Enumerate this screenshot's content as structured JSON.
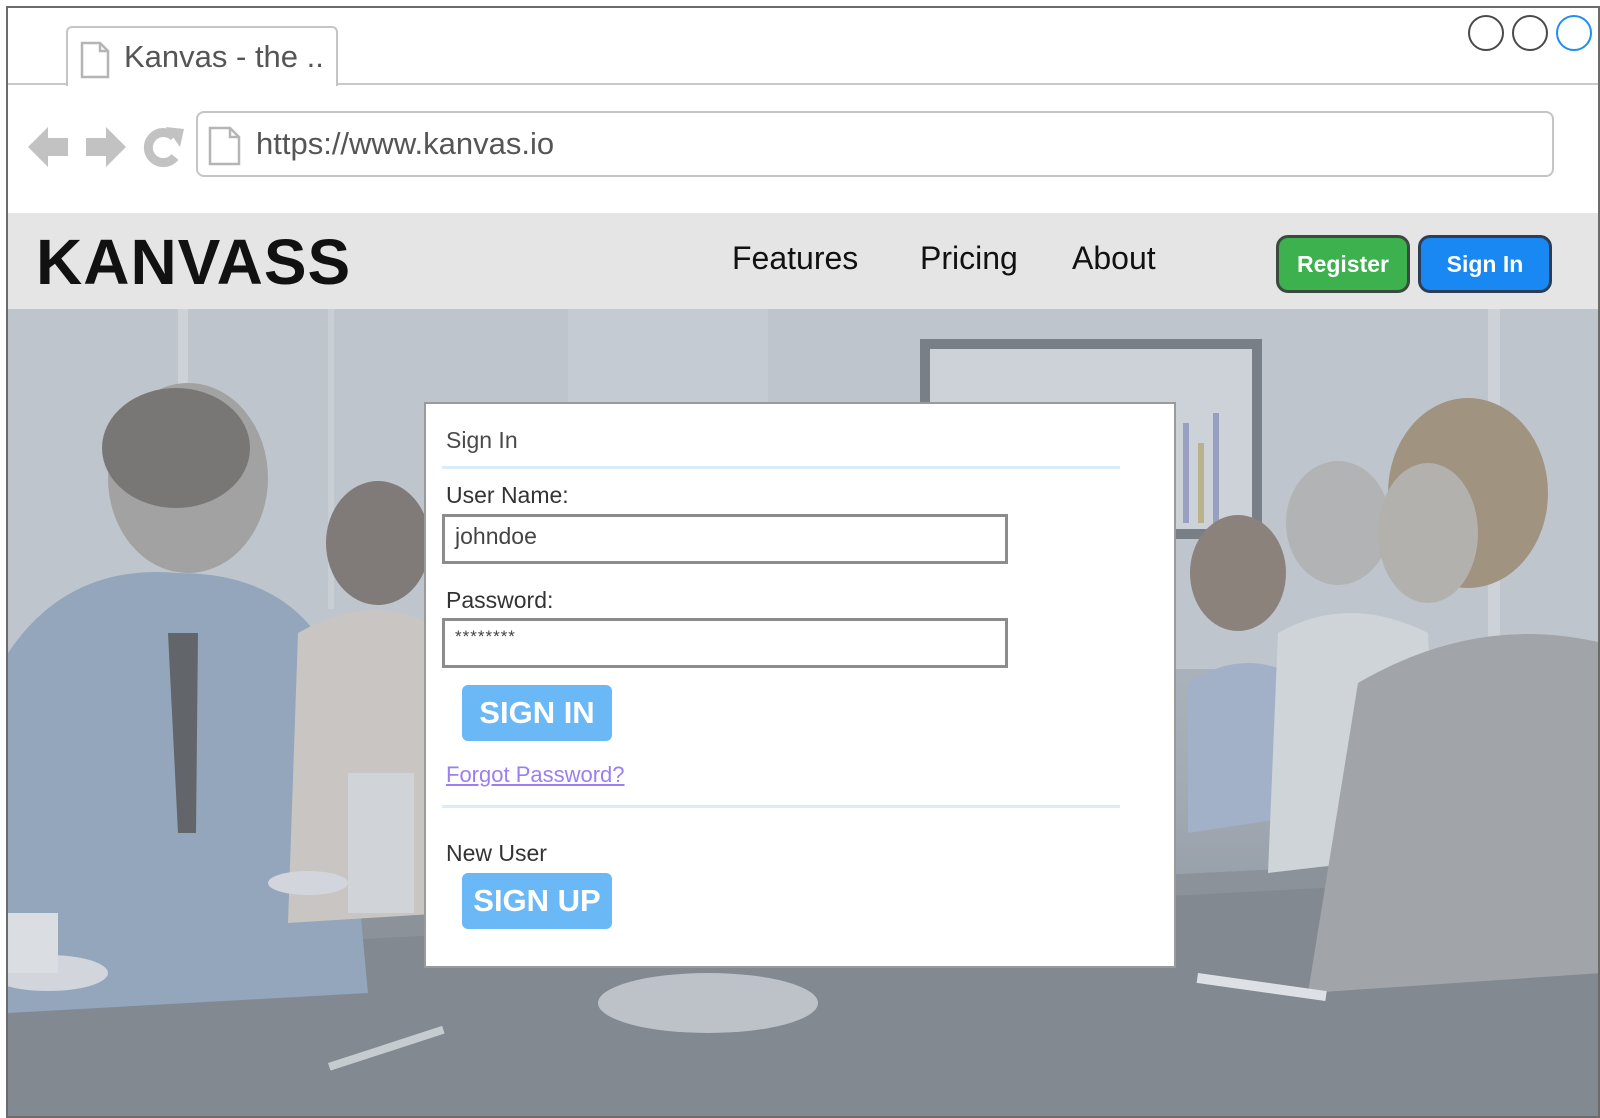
{
  "browser": {
    "tab_title": "Kanvas - the ..",
    "url": "https://www.kanvas.io"
  },
  "site": {
    "logo": "KANVASS",
    "nav": [
      "Features",
      "Pricing",
      "About"
    ],
    "register_label": "Register",
    "signin_label": "Sign In"
  },
  "signin_card": {
    "heading": "Sign In",
    "username_label": "User Name:",
    "username_value": "johndoe",
    "password_label": "Password:",
    "password_value": "********",
    "signin_button": "SIGN IN",
    "forgot_link": "Forgot Password?",
    "new_user_label": "New User",
    "signup_button": "SIGN UP"
  },
  "colors": {
    "register_green": "#3cb14d",
    "signin_blue": "#1988f3",
    "card_button_blue": "#6ab9f6",
    "link_purple": "#9a7ff0"
  },
  "icons": [
    "page-icon",
    "back-arrow-icon",
    "forward-arrow-icon",
    "reload-icon",
    "window-control-icon"
  ]
}
